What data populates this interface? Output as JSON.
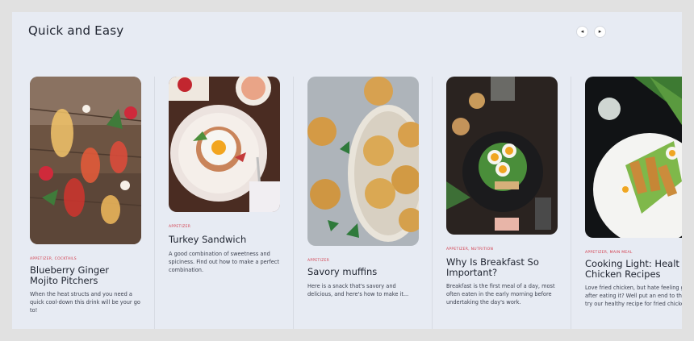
{
  "section": {
    "title": "Quick and Easy",
    "prev_icon": "◂",
    "next_icon": "▸"
  },
  "cards": [
    {
      "tags": "APPETIZER, COCKTAILS",
      "title_lines": [
        "Blueberry Ginger",
        "Mojito Pitchers"
      ],
      "desc": "When the heat structs and you need a quick cool-down this drink will  be your go to!"
    },
    {
      "tags": "APPETIZER",
      "title_lines": [
        "Turkey Sandwich"
      ],
      "desc": "A good combination of sweetness and spiciness. Find out how to make a perfect combination."
    },
    {
      "tags": "APPETIZER",
      "title_lines": [
        "Savory muffins"
      ],
      "desc": "Here is a snack that's savory and delicious, and here's how to make it..."
    },
    {
      "tags": "APPETIZER, NUTRITION",
      "title_lines": [
        "Why Is Breakfast So",
        "Important?"
      ],
      "desc": "Breakfast is the first meal of a day, most often eaten in the early morning before undertaking the day's work."
    },
    {
      "tags": "APPETIZER, MAIN MEAL",
      "title_lines": [
        "Cooking Light: Healt",
        "Chicken Recipes"
      ],
      "desc": "Love fried chicken, but hate feeling gu after eating it? Well put an end to that try our healthy recipe for  fried chicken"
    }
  ]
}
